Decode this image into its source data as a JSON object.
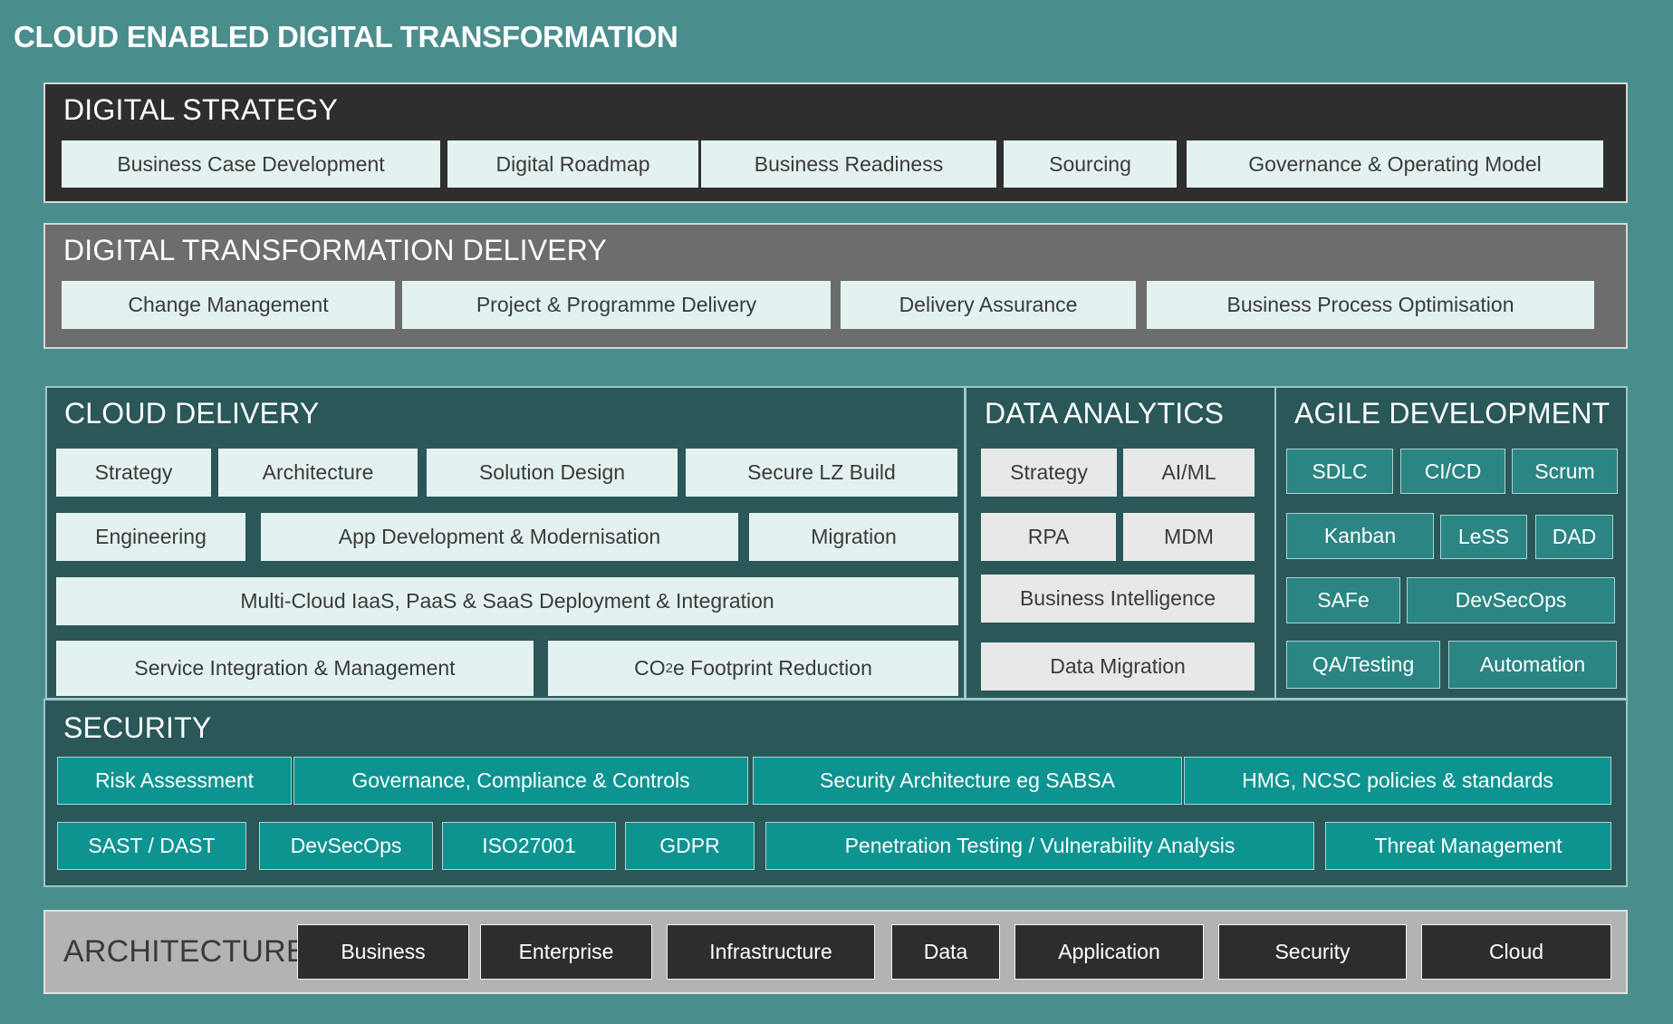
{
  "title": "CLOUD ENABLED DIGITAL TRANSFORMATION",
  "digital_strategy": {
    "heading": "DIGITAL STRATEGY",
    "items": [
      "Business Case Development",
      "Digital Roadmap",
      "Business Readiness",
      "Sourcing",
      "Governance & Operating Model"
    ]
  },
  "digital_transformation_delivery": {
    "heading": "DIGITAL TRANSFORMATION DELIVERY",
    "items": [
      "Change Management",
      "Project & Programme Delivery",
      "Delivery Assurance",
      "Business Process Optimisation"
    ]
  },
  "cloud_delivery": {
    "heading": "CLOUD DELIVERY",
    "items": [
      "Strategy",
      "Architecture",
      "Solution Design",
      "Secure LZ Build",
      "Engineering",
      "App Development & Modernisation",
      "Migration",
      "Multi-Cloud IaaS, PaaS & SaaS Deployment & Integration",
      "Service Integration & Management"
    ],
    "co2": {
      "prefix": "CO",
      "sub": "2",
      "suffix": "e Footprint Reduction"
    }
  },
  "data_analytics": {
    "heading": "DATA ANALYTICS",
    "items": [
      "Strategy",
      "AI/ML",
      "RPA",
      "MDM",
      "Business Intelligence",
      "Data Migration"
    ]
  },
  "agile_development": {
    "heading": "AGILE DEVELOPMENT",
    "items": [
      "SDLC",
      "CI/CD",
      "Scrum",
      "Kanban",
      "LeSS",
      "DAD",
      "SAFe",
      "DevSecOps",
      "QA/Testing",
      "Automation"
    ]
  },
  "security": {
    "heading": "SECURITY",
    "items": [
      "Risk Assessment",
      "Governance, Compliance & Controls",
      "Security Architecture eg SABSA",
      "HMG, NCSC policies & standards",
      "SAST / DAST",
      "DevSecOps",
      "ISO27001",
      "GDPR",
      "Penetration Testing / Vulnerability Analysis",
      "Threat Management"
    ]
  },
  "architecture": {
    "heading": "ARCHITECTURE",
    "items": [
      "Business",
      "Enterprise",
      "Infrastructure",
      "Data",
      "Application",
      "Security",
      "Cloud"
    ]
  },
  "colors": {
    "background": "#4a8d8d",
    "strategy_panel": "#2e2e2e",
    "delivery_panel": "#6d6d6d",
    "cloud_panel": "#2a5757",
    "security_box": "#0d9491",
    "architecture_panel": "#b3b3b3"
  }
}
